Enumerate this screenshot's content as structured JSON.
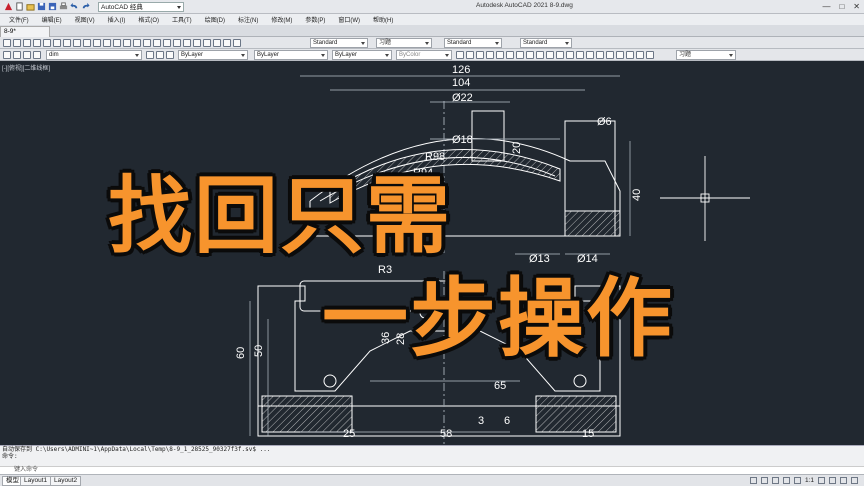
{
  "window": {
    "title": "Autodesk AutoCAD 2021   8-9.dwg",
    "workspace": "AutoCAD 经典",
    "controls": [
      "—",
      "□",
      "✕"
    ]
  },
  "menu": [
    "文件(F)",
    "编辑(E)",
    "视图(V)",
    "插入(I)",
    "格式(O)",
    "工具(T)",
    "绘图(D)",
    "标注(N)",
    "修改(M)",
    "参数(P)",
    "窗口(W)",
    "帮助(H)"
  ],
  "document_tab": "8-9*",
  "toolbar": {
    "textstyle": "Standard",
    "dimstyle": "习题",
    "tablestyle": "Standard",
    "mleaderstyle": "Standard",
    "layer": "dim",
    "color": "ByLayer",
    "linetype": "ByLayer",
    "lineweight": "ByLayer",
    "plotstyle": "ByColor",
    "extra": "习题"
  },
  "viewport_label": "[-][俯视][二维线框]",
  "dimensions": [
    "126",
    "104",
    "Ø22",
    "Ø6",
    "Ø18",
    "20",
    "R98",
    "R94",
    "40",
    "Ø13",
    "Ø14",
    "R3",
    "60",
    "50",
    "36",
    "28",
    "65",
    "3",
    "6",
    "25",
    "58",
    "15"
  ],
  "overlay": {
    "line1": "找回只需",
    "line2": "一步操作"
  },
  "command": {
    "line1": "自动保存到 C:\\Users\\ADMINI~1\\AppData\\Local\\Temp\\8-9_1_28525_90327f3f.sv$ ...",
    "line2": "命令:",
    "input_placeholder": "键入命令"
  },
  "layouts": [
    "模型",
    "Layout1",
    "Layout2"
  ],
  "status": {
    "scale": "1:1"
  },
  "colors": {
    "canvas": "#212830",
    "geometry": "#ffffff",
    "hatch": "#d8d8d8",
    "overlay_text": "#f7942d"
  }
}
